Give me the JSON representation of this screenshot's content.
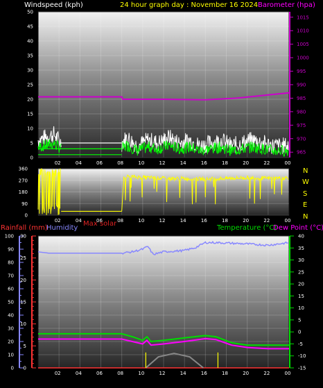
{
  "header": {
    "windspeed_label": "Windspeed (kph)",
    "title": "24 hour graph day : November 16 2024",
    "barometer_label": "Barometer (hpa)"
  },
  "direction_letters": [
    "N",
    "W",
    "S",
    "E",
    "N"
  ],
  "max_solar_label": "Max solar",
  "lower_header": {
    "rainfall_label": "Rainfall (mm)",
    "humidity_label": "Humidity",
    "temperature_label": "Temperature (°C)",
    "dewpoint_label": "Dew Point (°C)"
  },
  "colors": {
    "windspeed": "#ffffff",
    "gust": "#00ff00",
    "barometer": "#cc00cc",
    "direction": "#ffff00",
    "max_solar": "#dd2222",
    "rainfall": "#ff3333",
    "humidity": "#8888ff",
    "temperature": "#00dd00",
    "dewpoint": "#ff00ff",
    "solar": "#888888"
  },
  "chart_data": [
    {
      "type": "line",
      "name": "wind-barometer",
      "x_ticks": [
        "02",
        "04",
        "06",
        "08",
        "10",
        "12",
        "14",
        "16",
        "18",
        "20",
        "22",
        "00"
      ],
      "y_left_ticks": [
        "0",
        "5",
        "10",
        "15",
        "20",
        "25",
        "30",
        "35",
        "40",
        "45",
        "50"
      ],
      "y_left_lim": [
        0,
        50
      ],
      "y_right_ticks": [
        "965",
        "970",
        "975",
        "980",
        "985",
        "990",
        "995",
        "1000",
        "1005",
        "1010",
        "1015"
      ],
      "y_right_lim": [
        963,
        1017
      ],
      "series": [
        {
          "name": "Barometer (hpa)",
          "hours": [
            0,
            8,
            8.1,
            12,
            16,
            19,
            22,
            24
          ],
          "values": [
            985.5,
            985.5,
            984.6,
            984.6,
            984.4,
            985.0,
            986.2,
            987.0
          ]
        },
        {
          "name": "Windspeed (kph)",
          "hours": [
            0,
            1.5,
            2.2,
            8,
            8.5,
            9.5,
            10.5,
            11.5,
            12.5,
            13.5,
            14.5,
            15.5,
            16.5,
            17.5,
            18.5,
            19.5,
            20.5,
            21.5,
            22.5,
            24
          ],
          "values": [
            6,
            8,
            5,
            5,
            7,
            4,
            6,
            5,
            7,
            5,
            6,
            4,
            5,
            6,
            4,
            5,
            6,
            5,
            4,
            4
          ]
        }
      ]
    },
    {
      "type": "line",
      "name": "wind-direction",
      "x_ticks": [
        "02",
        "04",
        "06",
        "08",
        "10",
        "12",
        "14",
        "16",
        "18",
        "20",
        "22",
        "00"
      ],
      "y_ticks": [
        "0",
        "90",
        "180",
        "270",
        "360"
      ],
      "y_lim": [
        0,
        360
      ],
      "series": [
        {
          "name": "direction",
          "hours": [
            0,
            1.2,
            1.3,
            2.0,
            2.2,
            8,
            8.2,
            12,
            16,
            20,
            22,
            24
          ],
          "values": [
            320,
            300,
            20,
            310,
            30,
            30,
            300,
            285,
            280,
            290,
            285,
            290
          ]
        }
      ]
    },
    {
      "type": "line",
      "name": "rain-humidity-temperature",
      "x_ticks": [
        "02",
        "04",
        "06",
        "08",
        "10",
        "12",
        "14",
        "16",
        "18",
        "20",
        "22",
        "00"
      ],
      "y_humidity_ticks": [
        "0",
        "10",
        "20",
        "30",
        "40",
        "50",
        "60",
        "70",
        "80",
        "90",
        "100"
      ],
      "y_humidity_lim": [
        0,
        100
      ],
      "y_rain_ticks": [
        "0",
        "5",
        "10",
        "15",
        "20",
        "25",
        "30"
      ],
      "y_rain_lim": [
        0,
        30
      ],
      "y_temp_ticks": [
        "-15",
        "-10",
        "-5",
        "0",
        "5",
        "10",
        "15",
        "20",
        "25",
        "30",
        "35",
        "40"
      ],
      "y_temp_lim": [
        -15,
        40
      ],
      "series": [
        {
          "name": "Humidity",
          "hours": [
            0,
            1,
            4,
            8,
            9,
            10,
            10.5,
            11,
            12,
            14,
            15,
            16,
            17,
            20,
            22,
            24
          ],
          "values": [
            88,
            87,
            87,
            87,
            88,
            90,
            92,
            86,
            88,
            89,
            91,
            95,
            95,
            94,
            93,
            95
          ]
        },
        {
          "name": "Temperature (°C)",
          "hours": [
            0,
            8,
            9,
            10,
            10.4,
            10.8,
            12,
            14,
            16,
            17,
            18.5,
            20,
            22,
            24
          ],
          "values": [
            -0.8,
            -0.8,
            -2,
            -3.5,
            -2.0,
            -4,
            -3.5,
            -2.5,
            -1.5,
            -2,
            -4.5,
            -5.5,
            -5.5,
            -5.5
          ]
        },
        {
          "name": "Dew Point (°C)",
          "hours": [
            0,
            8,
            9,
            10,
            10.4,
            10.8,
            12,
            14,
            16,
            17,
            18.5,
            20,
            22,
            24
          ],
          "values": [
            -3.0,
            -3.0,
            -4,
            -5.0,
            -3.5,
            -5.5,
            -5,
            -4,
            -2.8,
            -3.2,
            -5.5,
            -6.5,
            -7.0,
            -7.0
          ]
        },
        {
          "name": "Rainfall (mm)",
          "hours": [
            0,
            24
          ],
          "values": [
            0,
            0
          ]
        },
        {
          "name": "solar",
          "hours": [
            10.3,
            11.5,
            13,
            14.5,
            15.8
          ],
          "values": [
            0,
            2.5,
            3.3,
            2.5,
            0
          ]
        }
      ]
    }
  ]
}
